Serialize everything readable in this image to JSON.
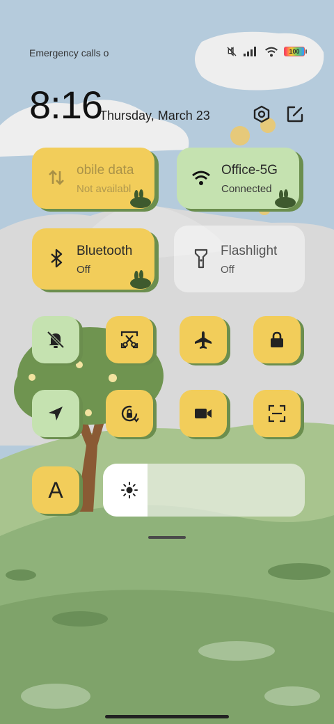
{
  "status_bar": {
    "carrier_text": "Emergency calls o",
    "battery": "100",
    "icons": [
      "mute-icon",
      "signal-icon",
      "wifi-icon",
      "battery-icon"
    ]
  },
  "header": {
    "time": "8:16",
    "date": "Thursday, March 23",
    "icons": [
      "settings-icon",
      "edit-icon"
    ]
  },
  "tiles": {
    "mobile_data": {
      "title": "obile data",
      "subtitle": "Not availabl",
      "icon": "data-arrows-icon",
      "color": "#f2cd5a"
    },
    "wifi": {
      "title": "Office-5G",
      "subtitle": "Connected",
      "icon": "wifi-icon",
      "color": "#c5e2b0"
    },
    "bluetooth": {
      "title": "Bluetooth",
      "subtitle": "Off",
      "icon": "bluetooth-icon",
      "color": "#f2cd5a"
    },
    "flashlight": {
      "title": "Flashlight",
      "subtitle": "Off",
      "icon": "flashlight-icon"
    }
  },
  "toggles": [
    {
      "name": "silent",
      "icon": "bell-off-icon",
      "color": "#c5e2b0"
    },
    {
      "name": "screenshot",
      "icon": "scissors-icon",
      "color": "#f2cd5a"
    },
    {
      "name": "airplane",
      "icon": "airplane-icon",
      "color": "#f2cd5a"
    },
    {
      "name": "lock",
      "icon": "lock-icon",
      "color": "#f2cd5a"
    },
    {
      "name": "location",
      "icon": "location-icon",
      "color": "#c5e2b0"
    },
    {
      "name": "rotation-lock",
      "icon": "rotation-lock-icon",
      "color": "#f2cd5a"
    },
    {
      "name": "screen-recorder",
      "icon": "video-icon",
      "color": "#f2cd5a"
    },
    {
      "name": "scanner",
      "icon": "scan-icon",
      "color": "#f2cd5a"
    }
  ],
  "font_size_toggle": {
    "label": "A",
    "color": "#f2cd5a"
  },
  "brightness": {
    "level": 0.22,
    "icon": "sun-icon"
  }
}
